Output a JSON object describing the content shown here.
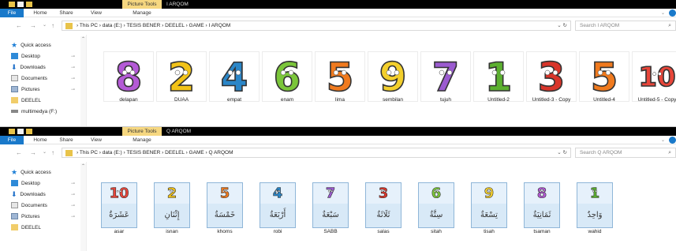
{
  "colors": {
    "accent": "#1979ca",
    "picture_tools": "#f6d780",
    "folder": "#e8c34a",
    "card_border": "#8fb6d8"
  },
  "windows": [
    {
      "ribbon": {
        "picture_tools": "Picture Tools",
        "title": "I ARQOM",
        "tabs": {
          "file": "File",
          "home": "Home",
          "share": "Share",
          "view": "View",
          "manage": "Manage"
        }
      },
      "nav": {
        "back": "←",
        "forward": "→",
        "recent": "⌄",
        "up": "↑"
      },
      "address": {
        "path": "›  This PC  ›  data (E:)  ›  TESIS BENER  ›  DEELEL  ›  GAME  ›  I ARQOM",
        "controls": "⌄  ↻"
      },
      "search": {
        "placeholder": "Search I ARQOM",
        "icon": "⌕"
      },
      "sidebar": [
        {
          "label": "Quick access",
          "icon": "star-icon",
          "pin": ""
        },
        {
          "label": "Desktop",
          "icon": "desktop-icon",
          "pin": "⊸"
        },
        {
          "label": "Downloads",
          "icon": "download-icon",
          "pin": "⊸"
        },
        {
          "label": "Documents",
          "icon": "documents-icon",
          "pin": "⊸"
        },
        {
          "label": "Pictures",
          "icon": "pictures-icon",
          "pin": "⊸"
        },
        {
          "label": "DEELEL",
          "icon": "folder-icon",
          "pin": ""
        },
        {
          "label": "multimedya (F:)",
          "icon": "drive-icon",
          "pin": ""
        }
      ],
      "files": [
        {
          "name": "delapan",
          "digit": "8",
          "color": "#b45ad6"
        },
        {
          "name": "DUAA",
          "digit": "2",
          "color": "#f2c318"
        },
        {
          "name": "empat",
          "digit": "4",
          "color": "#2a86c8"
        },
        {
          "name": "enam",
          "digit": "6",
          "color": "#7bc63a"
        },
        {
          "name": "lima",
          "digit": "5",
          "color": "#f07a1e"
        },
        {
          "name": "sembilan",
          "digit": "9",
          "color": "#f3cf2c"
        },
        {
          "name": "tujuh",
          "digit": "7",
          "color": "#9b5bd0"
        },
        {
          "name": "Untitled-2",
          "digit": "1",
          "color": "#5cb030"
        },
        {
          "name": "Untitled-3 - Copy",
          "digit": "3",
          "color": "#d8352a"
        },
        {
          "name": "Untitled-4",
          "digit": "5",
          "color": "#f07a1e"
        },
        {
          "name": "Untitled-5 - Copy",
          "digit": "10",
          "color": "#e8463a"
        }
      ]
    },
    {
      "ribbon": {
        "picture_tools": "Picture Tools",
        "title": "Q ARQOM",
        "tabs": {
          "file": "File",
          "home": "Home",
          "share": "Share",
          "view": "View",
          "manage": "Manage"
        }
      },
      "nav": {
        "back": "←",
        "forward": "→",
        "recent": "⌄",
        "up": "↑"
      },
      "address": {
        "path": "›  This PC  ›  data (E:)  ›  TESIS BENER  ›  DEELEL  ›  GAME  ›  Q ARQOM",
        "controls": "⌄  ↻"
      },
      "search": {
        "placeholder": "Search Q ARQOM",
        "icon": "⌕"
      },
      "sidebar": [
        {
          "label": "Quick access",
          "icon": "star-icon",
          "pin": ""
        },
        {
          "label": "Desktop",
          "icon": "desktop-icon",
          "pin": "⊸"
        },
        {
          "label": "Downloads",
          "icon": "download-icon",
          "pin": "⊸"
        },
        {
          "label": "Documents",
          "icon": "documents-icon",
          "pin": "⊸"
        },
        {
          "label": "Pictures",
          "icon": "pictures-icon",
          "pin": "⊸"
        },
        {
          "label": "DEELEL",
          "icon": "folder-icon",
          "pin": ""
        }
      ],
      "files": [
        {
          "name": "asar",
          "digit": "10",
          "color": "#e8463a",
          "arabic": "عَشَرَةٌ"
        },
        {
          "name": "isnan",
          "digit": "2",
          "color": "#f2c318",
          "arabic": "إِثْنَانِ"
        },
        {
          "name": "khoms",
          "digit": "5",
          "color": "#f07a1e",
          "arabic": "خَمْسَةٌ"
        },
        {
          "name": "robi",
          "digit": "4",
          "color": "#2a86c8",
          "arabic": "أَرْبَعَةٌ"
        },
        {
          "name": "SABB",
          "digit": "7",
          "color": "#9b5bd0",
          "arabic": "سَبْعَةٌ"
        },
        {
          "name": "salas",
          "digit": "3",
          "color": "#d8352a",
          "arabic": "ثَلَاثَةٌ"
        },
        {
          "name": "sitah",
          "digit": "6",
          "color": "#7bc63a",
          "arabic": "سِتَّةٌ"
        },
        {
          "name": "tisah",
          "digit": "9",
          "color": "#f3cf2c",
          "arabic": "تِسْعَةٌ"
        },
        {
          "name": "tsaman",
          "digit": "8",
          "color": "#b45ad6",
          "arabic": "ثَمَانِيَةٌ"
        },
        {
          "name": "wahid",
          "digit": "1",
          "color": "#5cb030",
          "arabic": "وَاحِدٌ"
        }
      ]
    }
  ]
}
